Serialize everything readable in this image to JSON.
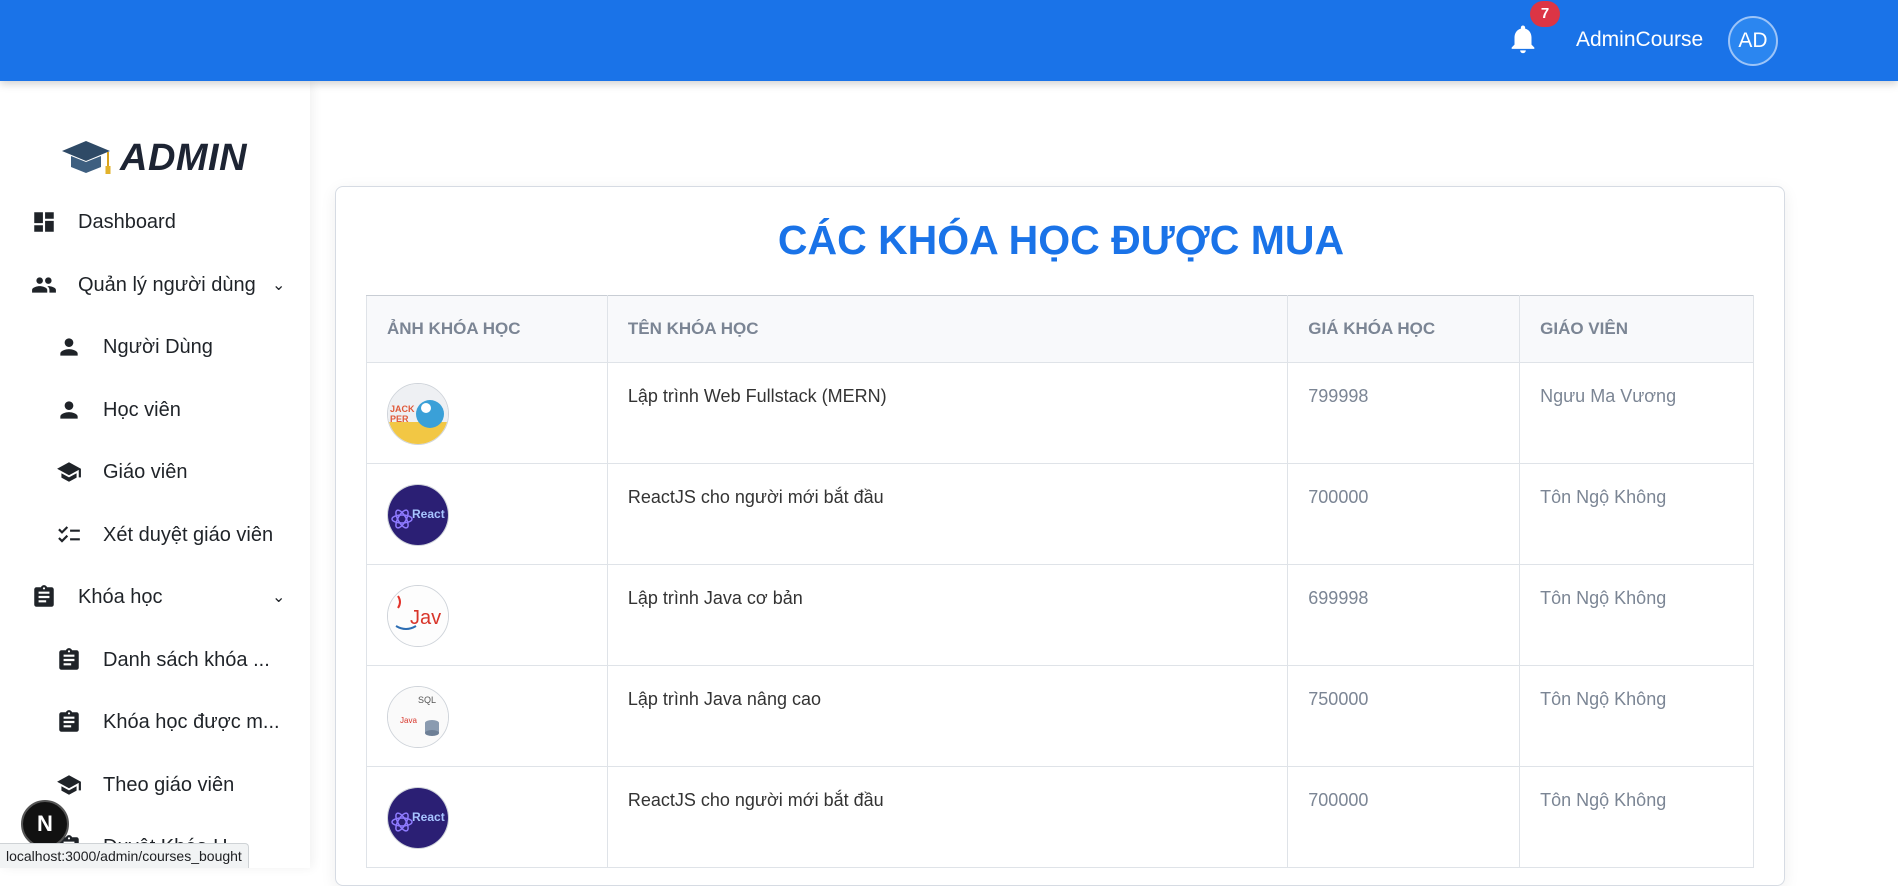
{
  "topbar": {
    "notification_count": "7",
    "admin_name": "AdminCourse",
    "avatar_initials": "AD",
    "color": "#1a73e8"
  },
  "sidebar": {
    "logo_text": "ADMIN",
    "items": [
      {
        "label": "Dashboard",
        "icon": "dashboard-icon",
        "level": 1
      },
      {
        "label": "Quản lý người dùng",
        "icon": "people-icon",
        "level": 1,
        "expandable": true
      },
      {
        "label": "Người Dùng",
        "icon": "person-icon",
        "level": 2
      },
      {
        "label": "Học viên",
        "icon": "person-icon",
        "level": 2
      },
      {
        "label": "Giáo viên",
        "icon": "school-icon",
        "level": 2
      },
      {
        "label": "Xét duyệt giáo viên",
        "icon": "checklist-icon",
        "level": 2
      },
      {
        "label": "Khóa học",
        "icon": "clipboard-icon",
        "level": 1,
        "expandable": true
      },
      {
        "label": "Danh sách khóa ...",
        "icon": "clipboard-icon",
        "level": 2
      },
      {
        "label": "Khóa học được m...",
        "icon": "clipboard-icon",
        "level": 2
      },
      {
        "label": "Theo giáo viên",
        "icon": "school-icon",
        "level": 2
      },
      {
        "label": "Duyệt Khóa H...",
        "icon": "clipboard-icon",
        "level": 2
      }
    ]
  },
  "status_bar": {
    "url": "localhost:3000/admin/courses_bought"
  },
  "fab": {
    "label": "N"
  },
  "main": {
    "title": "CÁC KHÓA HỌC ĐƯỢC MUA",
    "table": {
      "headers": [
        "ẢNH KHÓA HỌC",
        "TÊN KHÓA HỌC",
        "GIÁ KHÓA HỌC",
        "GIÁO VIÊN"
      ],
      "rows": [
        {
          "thumb": "fullstack-thumb",
          "name": "Lập trình Web Fullstack (MERN)",
          "price": "799998",
          "teacher": "Ngưu Ma Vương"
        },
        {
          "thumb": "react-thumb",
          "name": "ReactJS cho người mới bắt đầu",
          "price": "700000",
          "teacher": "Tôn Ngộ Không"
        },
        {
          "thumb": "java-thumb",
          "name": "Lập trình Java cơ bản",
          "price": "699998",
          "teacher": "Tôn Ngộ Không"
        },
        {
          "thumb": "java-advanced-thumb",
          "name": "Lập trình Java nâng cao",
          "price": "750000",
          "teacher": "Tôn Ngộ Không"
        },
        {
          "thumb": "react-thumb",
          "name": "ReactJS cho người mới bắt đầu",
          "price": "700000",
          "teacher": "Tôn Ngộ Không"
        }
      ]
    }
  }
}
